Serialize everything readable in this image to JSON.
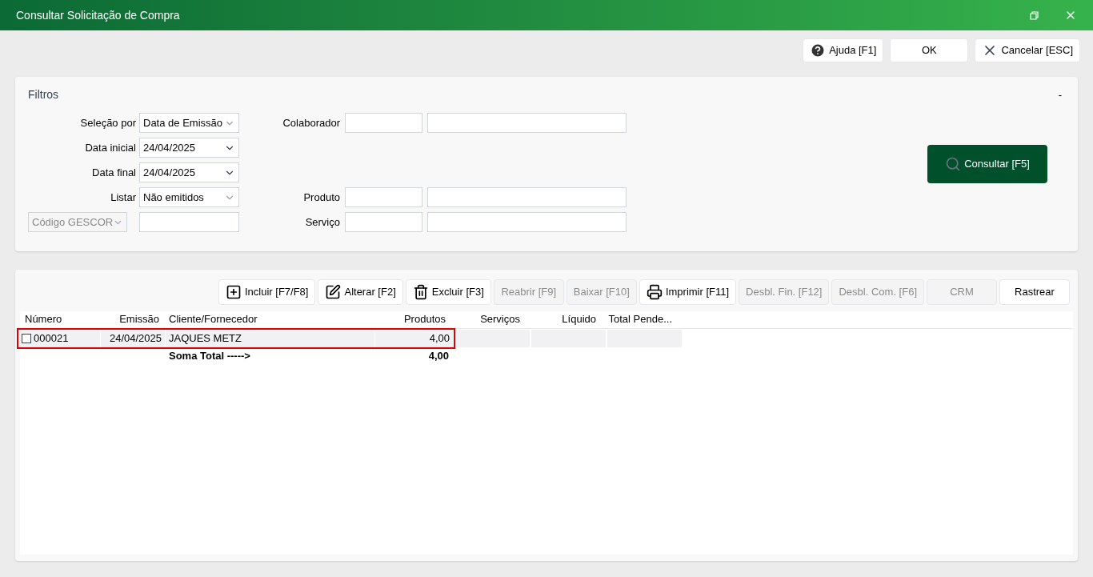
{
  "window": {
    "title": "Consultar Solicitação de Compra"
  },
  "top_buttons": [
    {
      "label": "Ajuda [F1]"
    },
    {
      "label": "OK"
    },
    {
      "label": "Cancelar [ESC]"
    }
  ],
  "filters": {
    "title": "Filtros",
    "collapse": "-",
    "left": [
      {
        "label": "Seleção por",
        "kind": "select",
        "value": "Data de Emissão",
        "right_label": "Colaborador"
      },
      {
        "label": "Data inicial",
        "kind": "date",
        "value": "24/04/2025"
      },
      {
        "label": "Data final",
        "kind": "date",
        "value": "24/04/2025"
      },
      {
        "label": "Listar",
        "kind": "select",
        "value": "Não emitidos",
        "right_label": "Produto"
      },
      {
        "kind": "select-input",
        "value": "Código GESCOR",
        "disabled": true,
        "right_label": "Serviço"
      }
    ],
    "search_button": "Consultar [F5]"
  },
  "toolbar": [
    {
      "label": "Incluir [F7/F8]",
      "disabled": false
    },
    {
      "label": "Alterar [F2]",
      "disabled": false
    },
    {
      "label": "Excluir [F3]",
      "disabled": false
    },
    {
      "label": "Reabrir [F9]",
      "disabled": true
    },
    {
      "label": "Baixar [F10]",
      "disabled": true
    },
    {
      "label": "Imprimir [F11]",
      "disabled": false
    },
    {
      "label": "Desbl. Fin. [F12]",
      "disabled": true
    },
    {
      "label": "Desbl. Com. [F6]",
      "disabled": true
    },
    {
      "label": "CRM",
      "disabled": true
    },
    {
      "label": "Rastrear",
      "disabled": false
    }
  ],
  "table": {
    "columns": [
      "Número",
      "Emissão",
      "Cliente/Fornecedor",
      "Produtos",
      "Serviços",
      "Líquido",
      "Total Pende..."
    ],
    "rows": [
      {
        "cells": [
          "000021",
          "24/04/2025",
          "JAQUES METZ",
          "4,00",
          "",
          "",
          ""
        ],
        "checked": false,
        "highlighted": true
      }
    ],
    "total": {
      "label": "Soma Total ----->",
      "value": "4,00"
    }
  }
}
